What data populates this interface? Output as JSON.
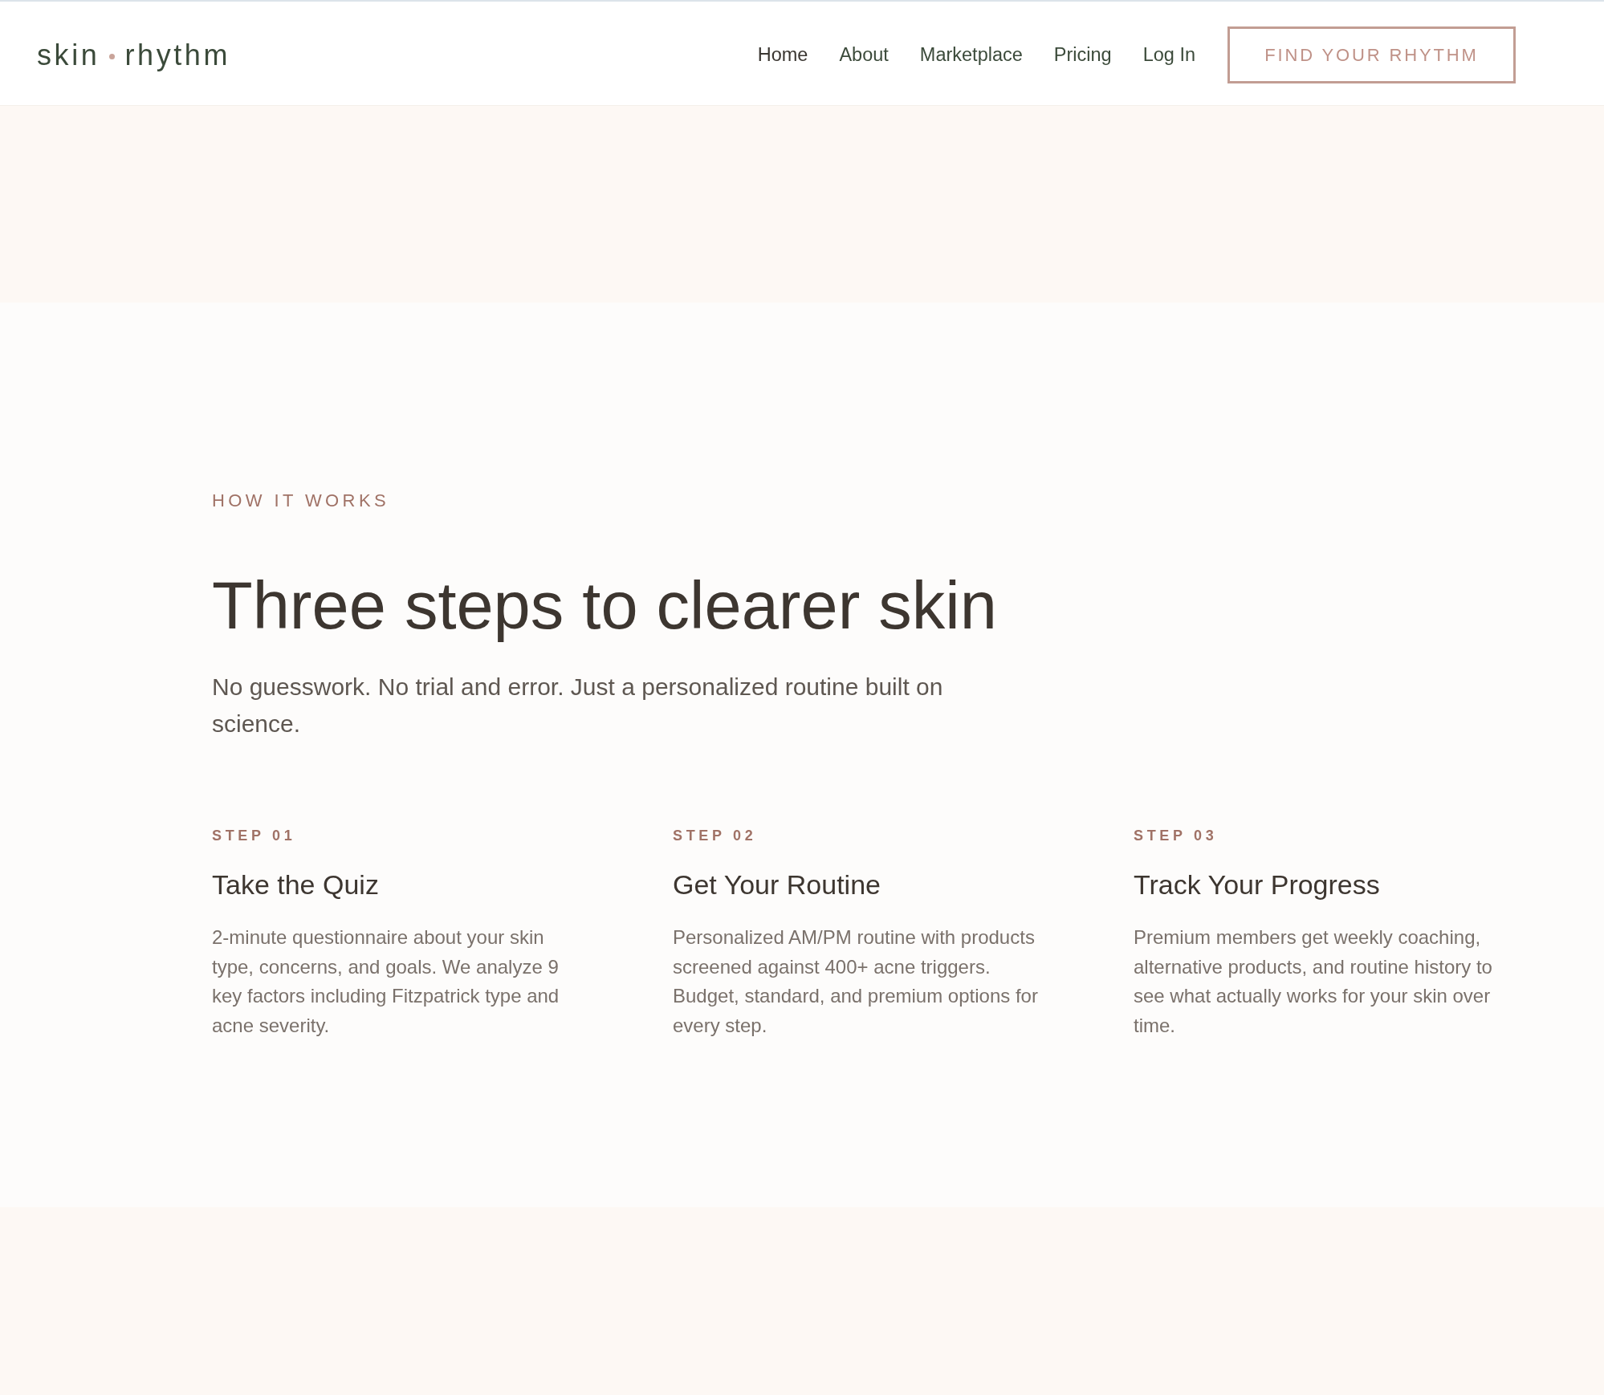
{
  "header": {
    "logo": {
      "first_word": "skin",
      "second_word": "rhythm"
    },
    "nav": [
      {
        "label": "Home",
        "selected": true
      },
      {
        "label": "About",
        "selected": false
      },
      {
        "label": "Marketplace",
        "selected": false
      },
      {
        "label": "Pricing",
        "selected": false
      },
      {
        "label": "Log In",
        "selected": false
      }
    ],
    "cta": "FIND YOUR RHYTHM"
  },
  "how_it_works": {
    "eyebrow": "HOW IT WORKS",
    "title": "Three steps to clearer skin",
    "subtitle": "No guesswork. No trial and error. Just a personalized routine built on science.",
    "steps": [
      {
        "label": "STEP 01",
        "title": "Take the Quiz",
        "description": "2-minute questionnaire about your skin type, concerns, and goals. We analyze 9 key factors including Fitzpatrick type and acne severity."
      },
      {
        "label": "STEP 02",
        "title": "Get Your Routine",
        "description": "Personalized AM/PM routine with products screened against 400+ acne triggers. Budget, standard, and premium options for every step."
      },
      {
        "label": "STEP 03",
        "title": "Track Your Progress",
        "description": "Premium members get weekly coaching, alternative products, and routine history to see what actually works for your skin over time."
      }
    ]
  }
}
